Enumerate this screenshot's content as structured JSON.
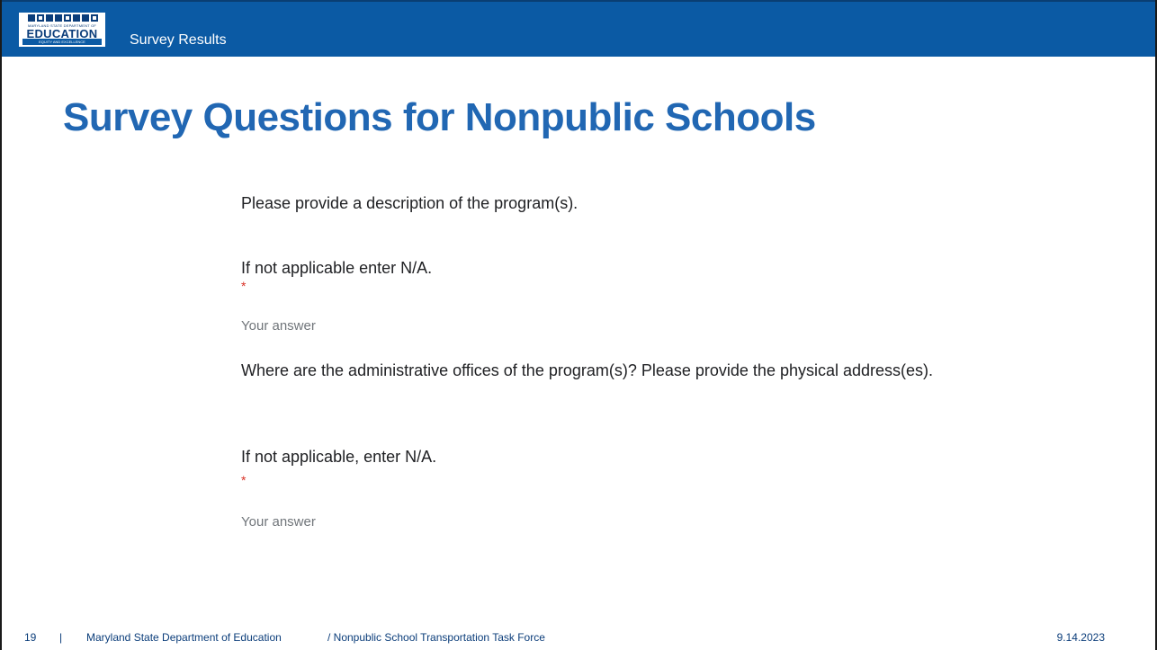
{
  "header": {
    "logo": {
      "main_text": "EDUCATION",
      "small_text": "MARYLAND STATE DEPARTMENT OF",
      "tagline": "EQUITY AND EXCELLENCE"
    },
    "section_label": "Survey Results",
    "bar_color": "#0b5aa4"
  },
  "slide": {
    "title": "Survey Questions for Nonpublic Schools",
    "title_color": "#2167b3"
  },
  "questions": [
    {
      "text": "Please provide a description of the program(s).",
      "instruction": "If not applicable enter N/A.",
      "required_marker": "*",
      "placeholder": "Your answer"
    },
    {
      "text": "Where are the administrative offices of the program(s)? Please provide the physical address(es).",
      "instruction": "If not applicable, enter N/A.",
      "required_marker": "*",
      "placeholder": "Your answer"
    }
  ],
  "footer": {
    "page_number": "19",
    "separator": "|",
    "organization": "Maryland State Department of Education",
    "task_force": "/ Nonpublic School Transportation Task Force",
    "date": "9.14.2023"
  }
}
